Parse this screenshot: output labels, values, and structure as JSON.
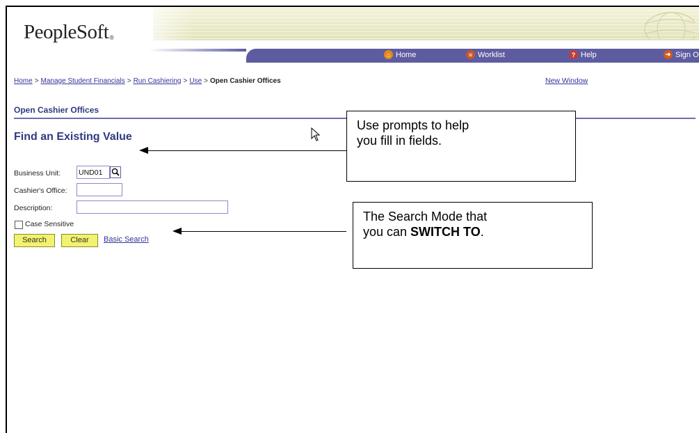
{
  "header": {
    "logo_text": "PeopleSoft",
    "logo_mark": "®",
    "nav": [
      {
        "label": "Home",
        "icon": "home-icon"
      },
      {
        "label": "Worklist",
        "icon": "worklist-icon"
      },
      {
        "label": "Help",
        "icon": "help-icon"
      },
      {
        "label": "Sign O",
        "icon": "sign-out-icon"
      }
    ],
    "colors": {
      "nav_bar": "#5e5ca0",
      "band": "#e2e2ba"
    }
  },
  "breadcrumb": {
    "items": [
      "Home",
      "Manage Student Financials",
      "Run Cashiering",
      "Use"
    ],
    "separator": ">",
    "current": "Open Cashier Offices",
    "new_window": "New Window"
  },
  "page": {
    "title": "Open Cashier Offices",
    "heading": "Find an Existing Value"
  },
  "form": {
    "business_unit_label": "Business Unit:",
    "business_unit_value": "UND01",
    "cashier_office_label": "Cashier's Office:",
    "cashier_office_value": "",
    "description_label": "Description:",
    "description_value": "",
    "case_sensitive_label": "Case Sensitive",
    "case_sensitive_checked": false,
    "search_button": "Search",
    "clear_button": "Clear",
    "basic_search_link": "Basic Search"
  },
  "callouts": {
    "prompts_line1": "Use prompts to help",
    "prompts_line2": "you fill in fields.",
    "mode_line1": "The Search Mode that",
    "mode_line2_prefix": "you can ",
    "mode_line2_bold": "SWITCH TO",
    "mode_line2_suffix": "."
  },
  "colors": {
    "button_fill": "#f2f26e",
    "heading": "#2e3a80",
    "link": "#333399"
  }
}
